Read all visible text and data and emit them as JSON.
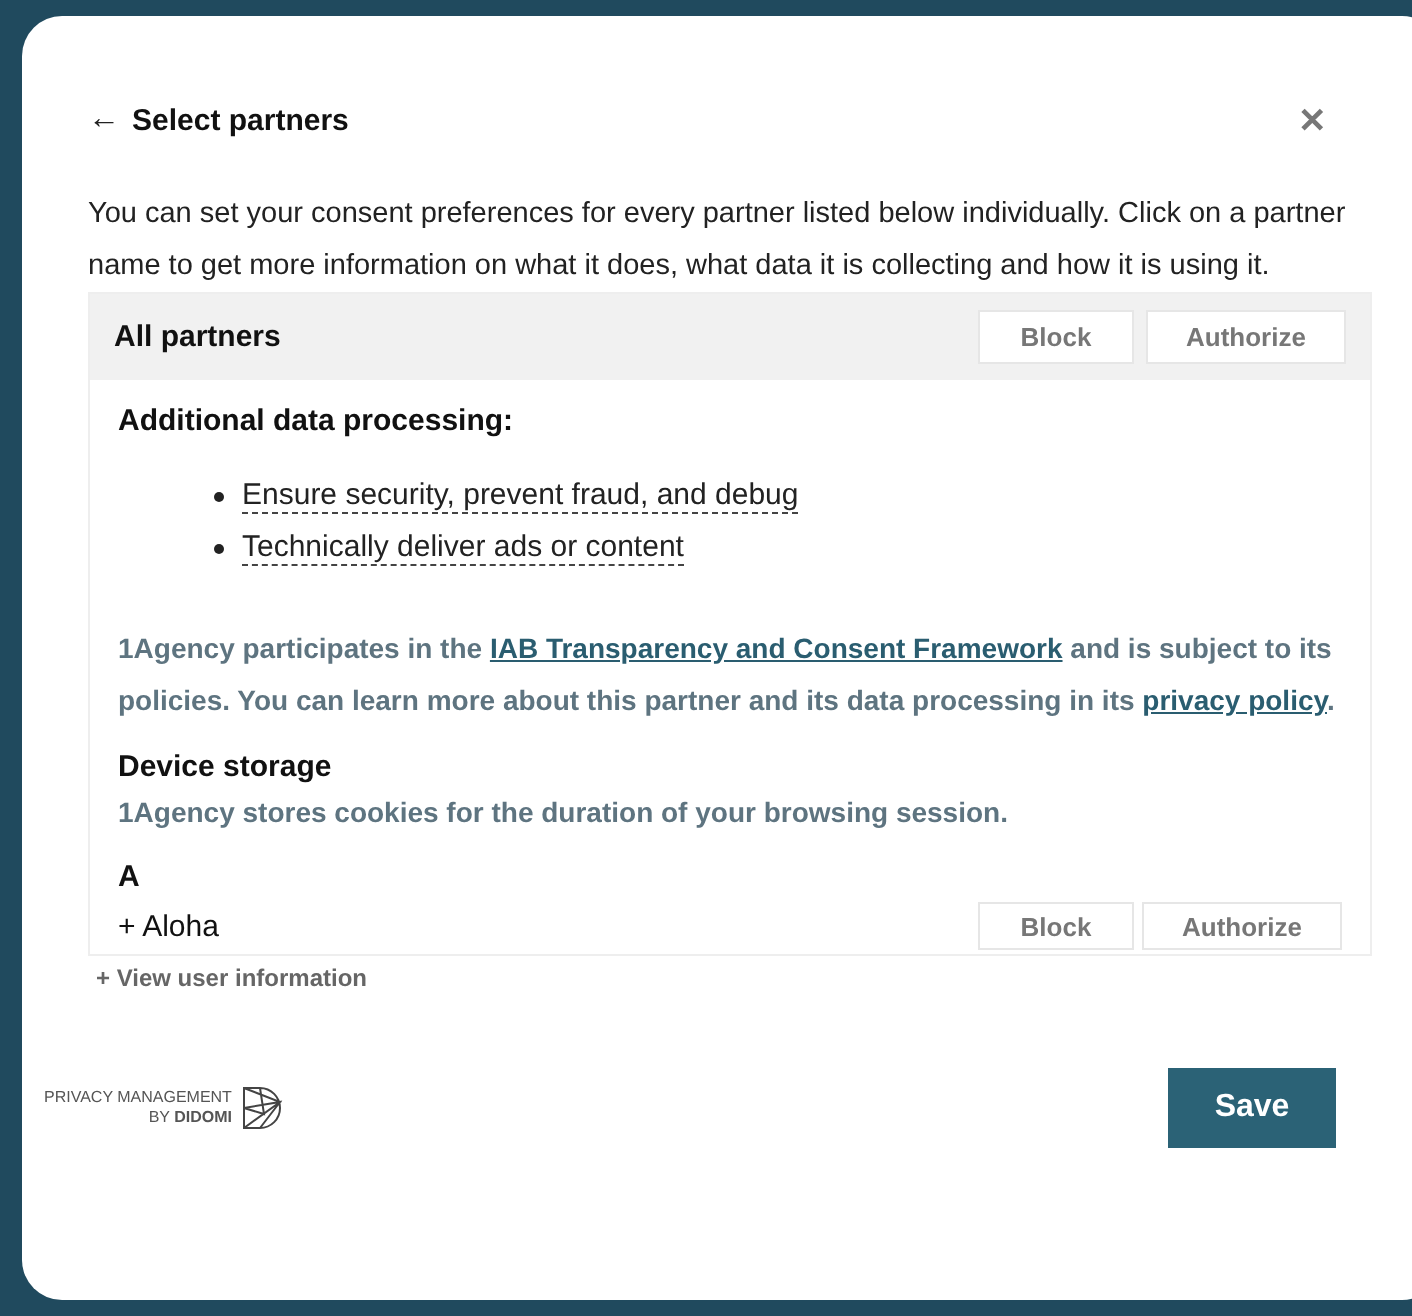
{
  "header": {
    "back": "←",
    "title": "Select partners",
    "close": "✕"
  },
  "intro": "You can set your consent preferences for every partner listed below individually. Click on a partner name to get more information on what it does, what data it is collecting and how it is using it.",
  "all_partners": {
    "label": "All partners",
    "buttons": [
      "Block",
      "Authorize"
    ]
  },
  "details": {
    "heading": "Additional data processing:",
    "purposes": [
      "Ensure security, prevent fraud, and debug",
      "Technically deliver ads or content"
    ],
    "policy": [
      {
        "kind": "text",
        "text": "1Agency participates in the "
      },
      {
        "kind": "link",
        "text": "IAB Transparency and Consent Framework"
      },
      {
        "kind": "text",
        "text": " and is subject to its policies. You can learn more about this partner and its data processing in its "
      },
      {
        "kind": "link",
        "text": "privacy policy"
      },
      {
        "kind": "text",
        "text": "."
      }
    ],
    "storage_heading": "Device storage",
    "storage_text": "1Agency stores cookies for the duration of your browsing session."
  },
  "letter": "A",
  "partners": [
    {
      "expander": "+",
      "name": "Aloha",
      "buttons": [
        "Block",
        "Authorize"
      ]
    }
  ],
  "view_user_info": "+ View user information",
  "branding": {
    "line1": "PRIVACY MANAGEMENT",
    "line2_prefix": "BY",
    "line2_brand": "DIDOMI"
  },
  "save": "Save"
}
